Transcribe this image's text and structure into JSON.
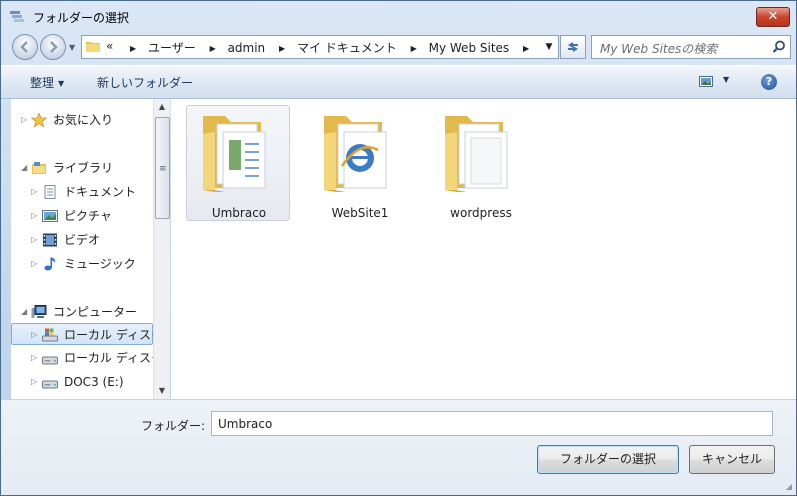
{
  "window": {
    "title": "フォルダーの選択",
    "close_label": "✕"
  },
  "address_bar": {
    "overflow_chevron": "«",
    "crumbs": [
      "ユーザー",
      "admin",
      "マイ ドキュメント",
      "My Web Sites"
    ]
  },
  "search": {
    "placeholder": "My Web Sitesの検索"
  },
  "toolbar": {
    "organize_label": "整理",
    "new_folder_label": "新しいフォルダー"
  },
  "nav_pane": {
    "items": [
      {
        "label": "お気に入り",
        "icon": "star-icon"
      },
      {
        "label": "ライブラリ",
        "icon": "library-icon"
      },
      {
        "label": "ドキュメント",
        "icon": "document-icon"
      },
      {
        "label": "ピクチャ",
        "icon": "picture-icon"
      },
      {
        "label": "ビデオ",
        "icon": "video-icon"
      },
      {
        "label": "ミュージック",
        "icon": "music-icon"
      },
      {
        "label": "コンピューター",
        "icon": "computer-icon"
      },
      {
        "label": "ローカル ディスク",
        "icon": "windows-drive-icon"
      },
      {
        "label": "ローカル ディスク",
        "icon": "drive-icon"
      },
      {
        "label": "DOC3 (E:)",
        "icon": "drive-icon"
      }
    ]
  },
  "content": {
    "folders": [
      {
        "label": "Umbraco",
        "icon": "folder-documents-icon"
      },
      {
        "label": "WebSite1",
        "icon": "folder-web-icon"
      },
      {
        "label": "wordpress",
        "icon": "folder-pages-icon"
      }
    ]
  },
  "bottom": {
    "folder_label": "フォルダー:",
    "folder_value": "Umbraco",
    "select_button": "フォルダーの選択",
    "cancel_button": "キャンセル"
  },
  "colors": {
    "folder_yellow": "#f2cf6b",
    "selection_border": "#84acdd",
    "close_red": "#c8452c"
  }
}
